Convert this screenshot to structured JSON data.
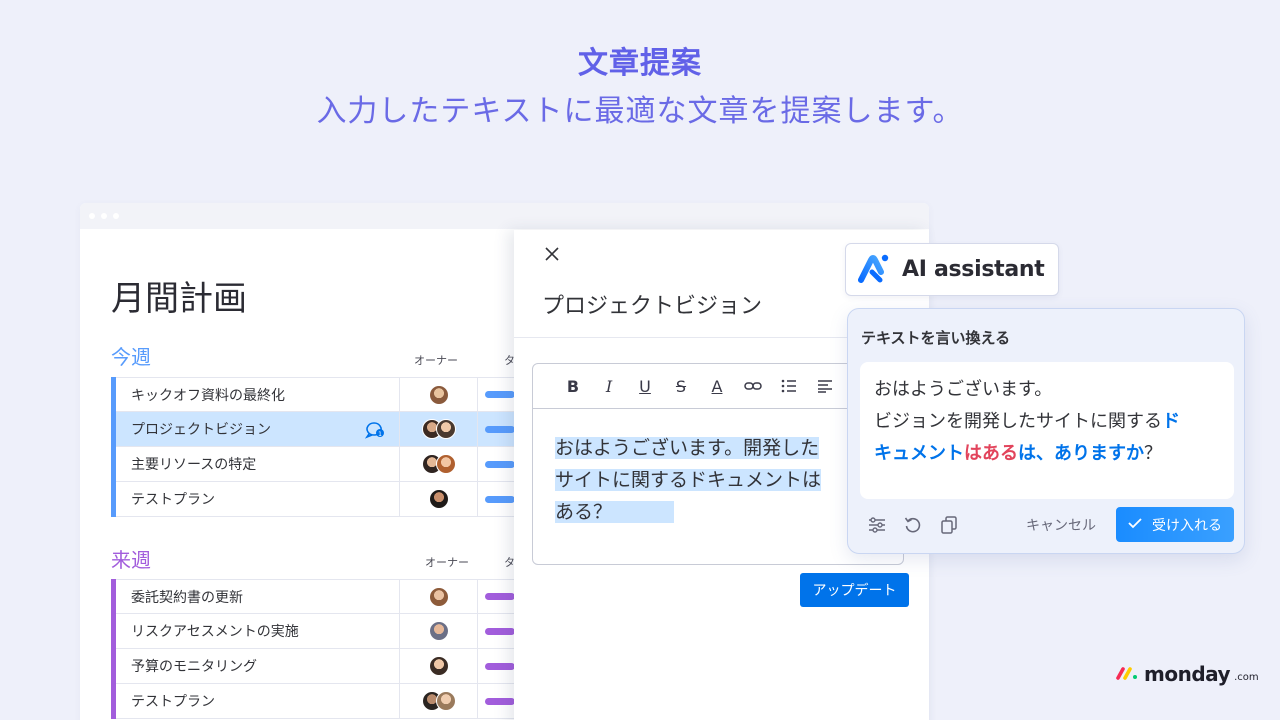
{
  "hero": {
    "title": "文章提案",
    "subtitle": "入力したテキストに最適な文章を提案します。"
  },
  "board": {
    "title": "月間計画",
    "groups": [
      {
        "name": "今週",
        "color": "#579bfc",
        "owner_col": "オーナー",
        "status_col": "タ",
        "rows": [
          {
            "name": "キックオフ資料の最終化",
            "selected": false
          },
          {
            "name": "プロジェクトビジョン",
            "selected": true
          },
          {
            "name": "主要リソースの特定",
            "selected": false
          },
          {
            "name": "テストプラン",
            "selected": false
          }
        ]
      },
      {
        "name": "来週",
        "color": "#a25ddc",
        "owner_col": "オーナー",
        "status_col": "タ",
        "rows": [
          {
            "name": "委託契約書の更新",
            "selected": false
          },
          {
            "name": "リスクアセスメントの実施",
            "selected": false
          },
          {
            "name": "予算のモニタリング",
            "selected": false
          },
          {
            "name": "テストプラン",
            "selected": false
          }
        ]
      }
    ]
  },
  "panel": {
    "title": "プロジェクトビジョン",
    "editor_lines": [
      "おはようございます。開発した",
      "サイトに関するドキュメントは",
      "ある？"
    ],
    "update_label": "アップデート"
  },
  "ai_badge": {
    "label": "AI assistant"
  },
  "rephrase": {
    "title": "テキストを言い換える",
    "line1": "おはようございます。",
    "line2_plain": "ビジョンを開発したサイトに関する",
    "line2_new": "ド",
    "line3_new": "キュメント",
    "line3_del": "はある",
    "line3_new2": "は、ありますか",
    "line3_end": "？",
    "cancel_label": "キャンセル",
    "accept_label": "受け入れる"
  },
  "logo": {
    "word": "monday",
    "suffix": ".com"
  },
  "colors": {
    "accent": "#0073ea",
    "hero": "#6161e8",
    "deleted": "#e2445c",
    "group1": "#579bfc",
    "group2": "#a25ddc"
  }
}
